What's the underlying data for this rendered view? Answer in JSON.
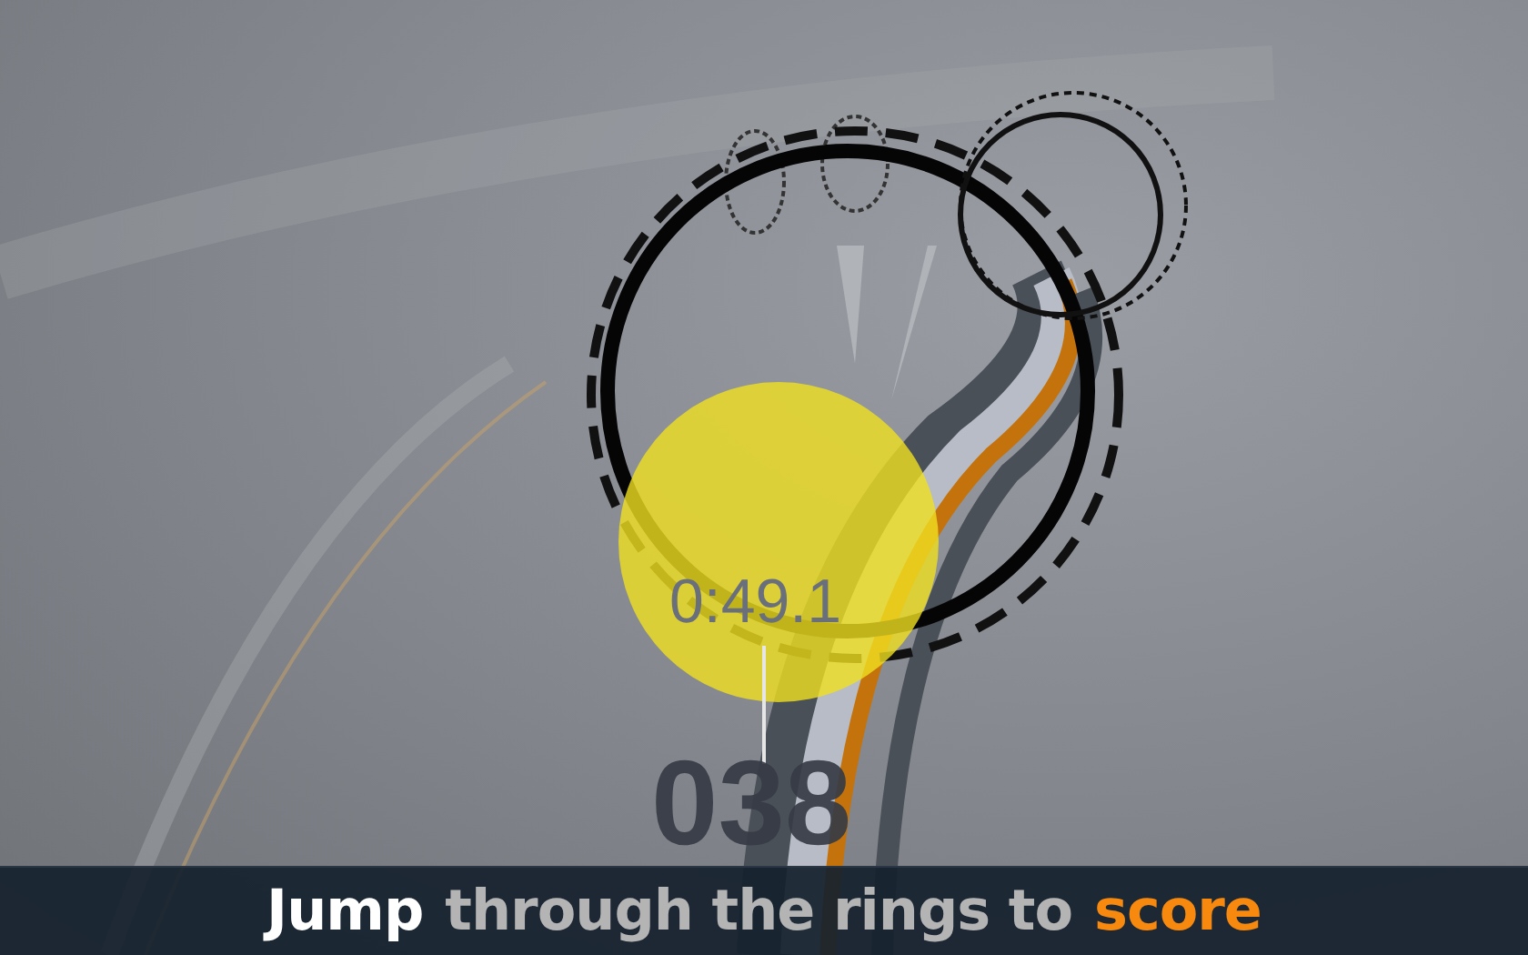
{
  "hud": {
    "timer": "0:49.1",
    "score": "038"
  },
  "caption": [
    {
      "text": "Jump",
      "color": "#ffffff"
    },
    {
      "text": "through the rings to",
      "color": "#b4b4b4"
    },
    {
      "text": "score",
      "color": "#f7890f"
    }
  ]
}
